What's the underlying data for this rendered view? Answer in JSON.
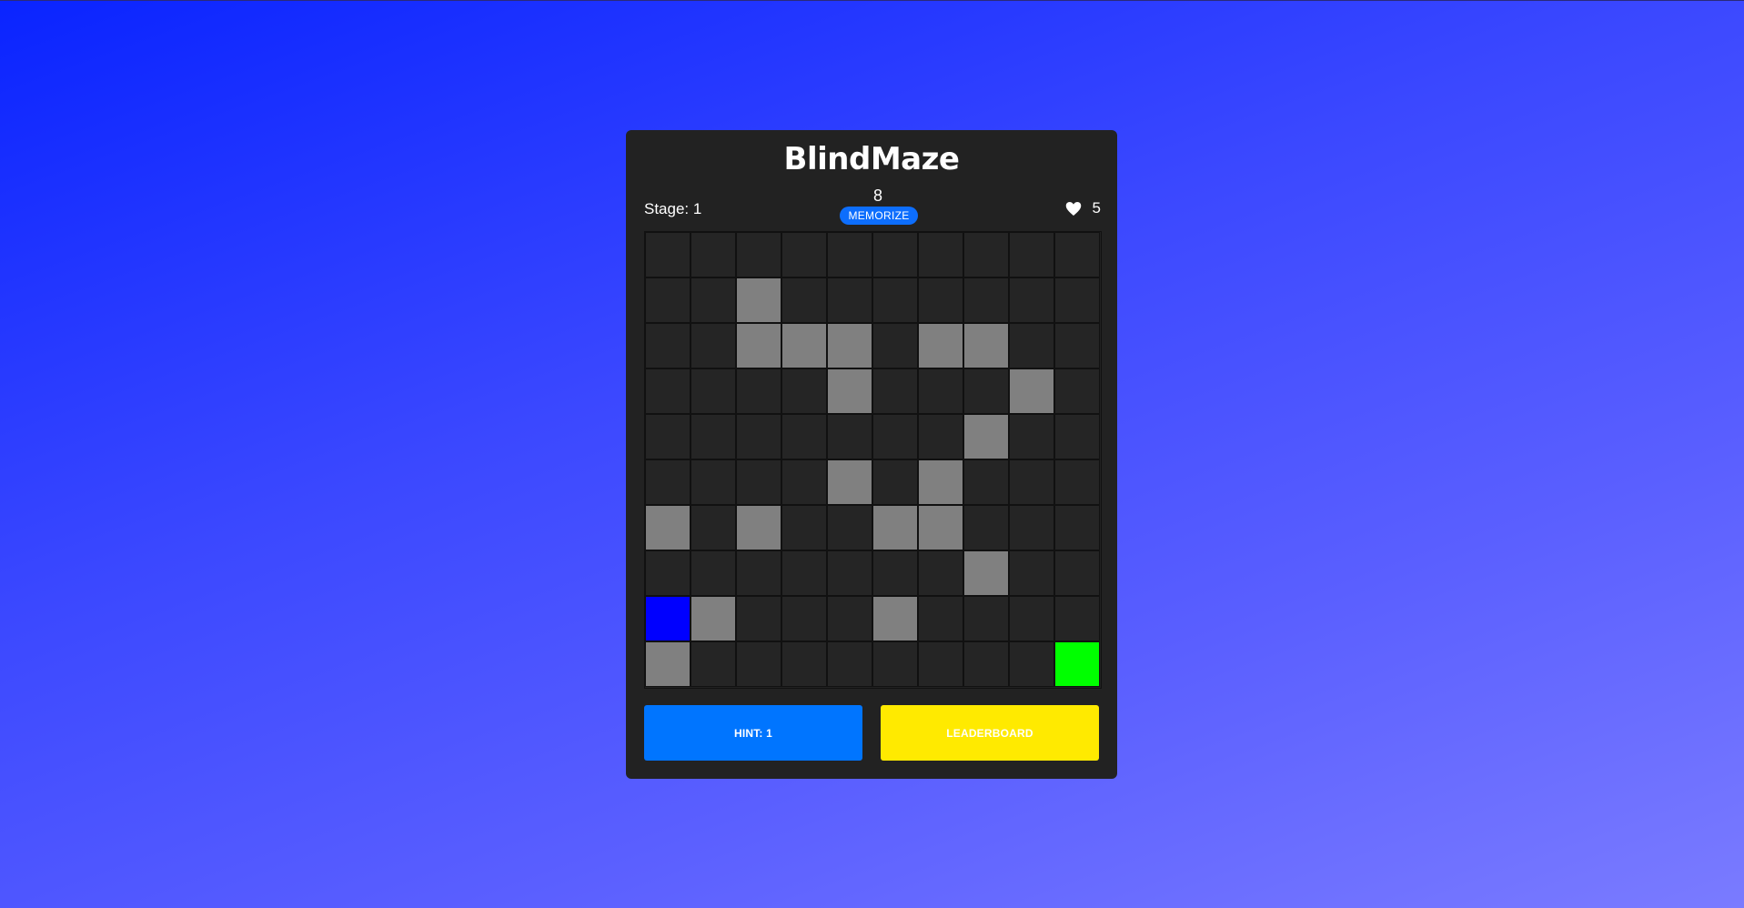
{
  "app": {
    "title": "BlindMaze"
  },
  "status": {
    "stage_label": "Stage: 1",
    "timer": "8",
    "phase_badge": "MEMORIZE",
    "lives": "5",
    "lives_icon": "heart-icon"
  },
  "board": {
    "rows": 10,
    "cols": 10,
    "legend": {
      ".": "empty",
      "#": "wall",
      "P": "player",
      "G": "goal"
    },
    "grid": [
      "..........",
      "..#.......",
      "..###.##..",
      "....#...#.",
      ".......#..",
      "....#.#...",
      "#.#..##...",
      ".......#..",
      "P#...#....",
      "#........G"
    ],
    "colors": {
      "empty": "#252525",
      "wall": "#808080",
      "player": "#0000ff",
      "goal": "#00ff00"
    }
  },
  "buttons": {
    "hint_label": "HINT: 1",
    "leaderboard_label": "LEADERBOARD"
  },
  "theme": {
    "card_bg": "#222222",
    "hint_color": "#0075ff",
    "leaderboard_color": "#ffea00",
    "badge_color": "#0d6efd"
  }
}
